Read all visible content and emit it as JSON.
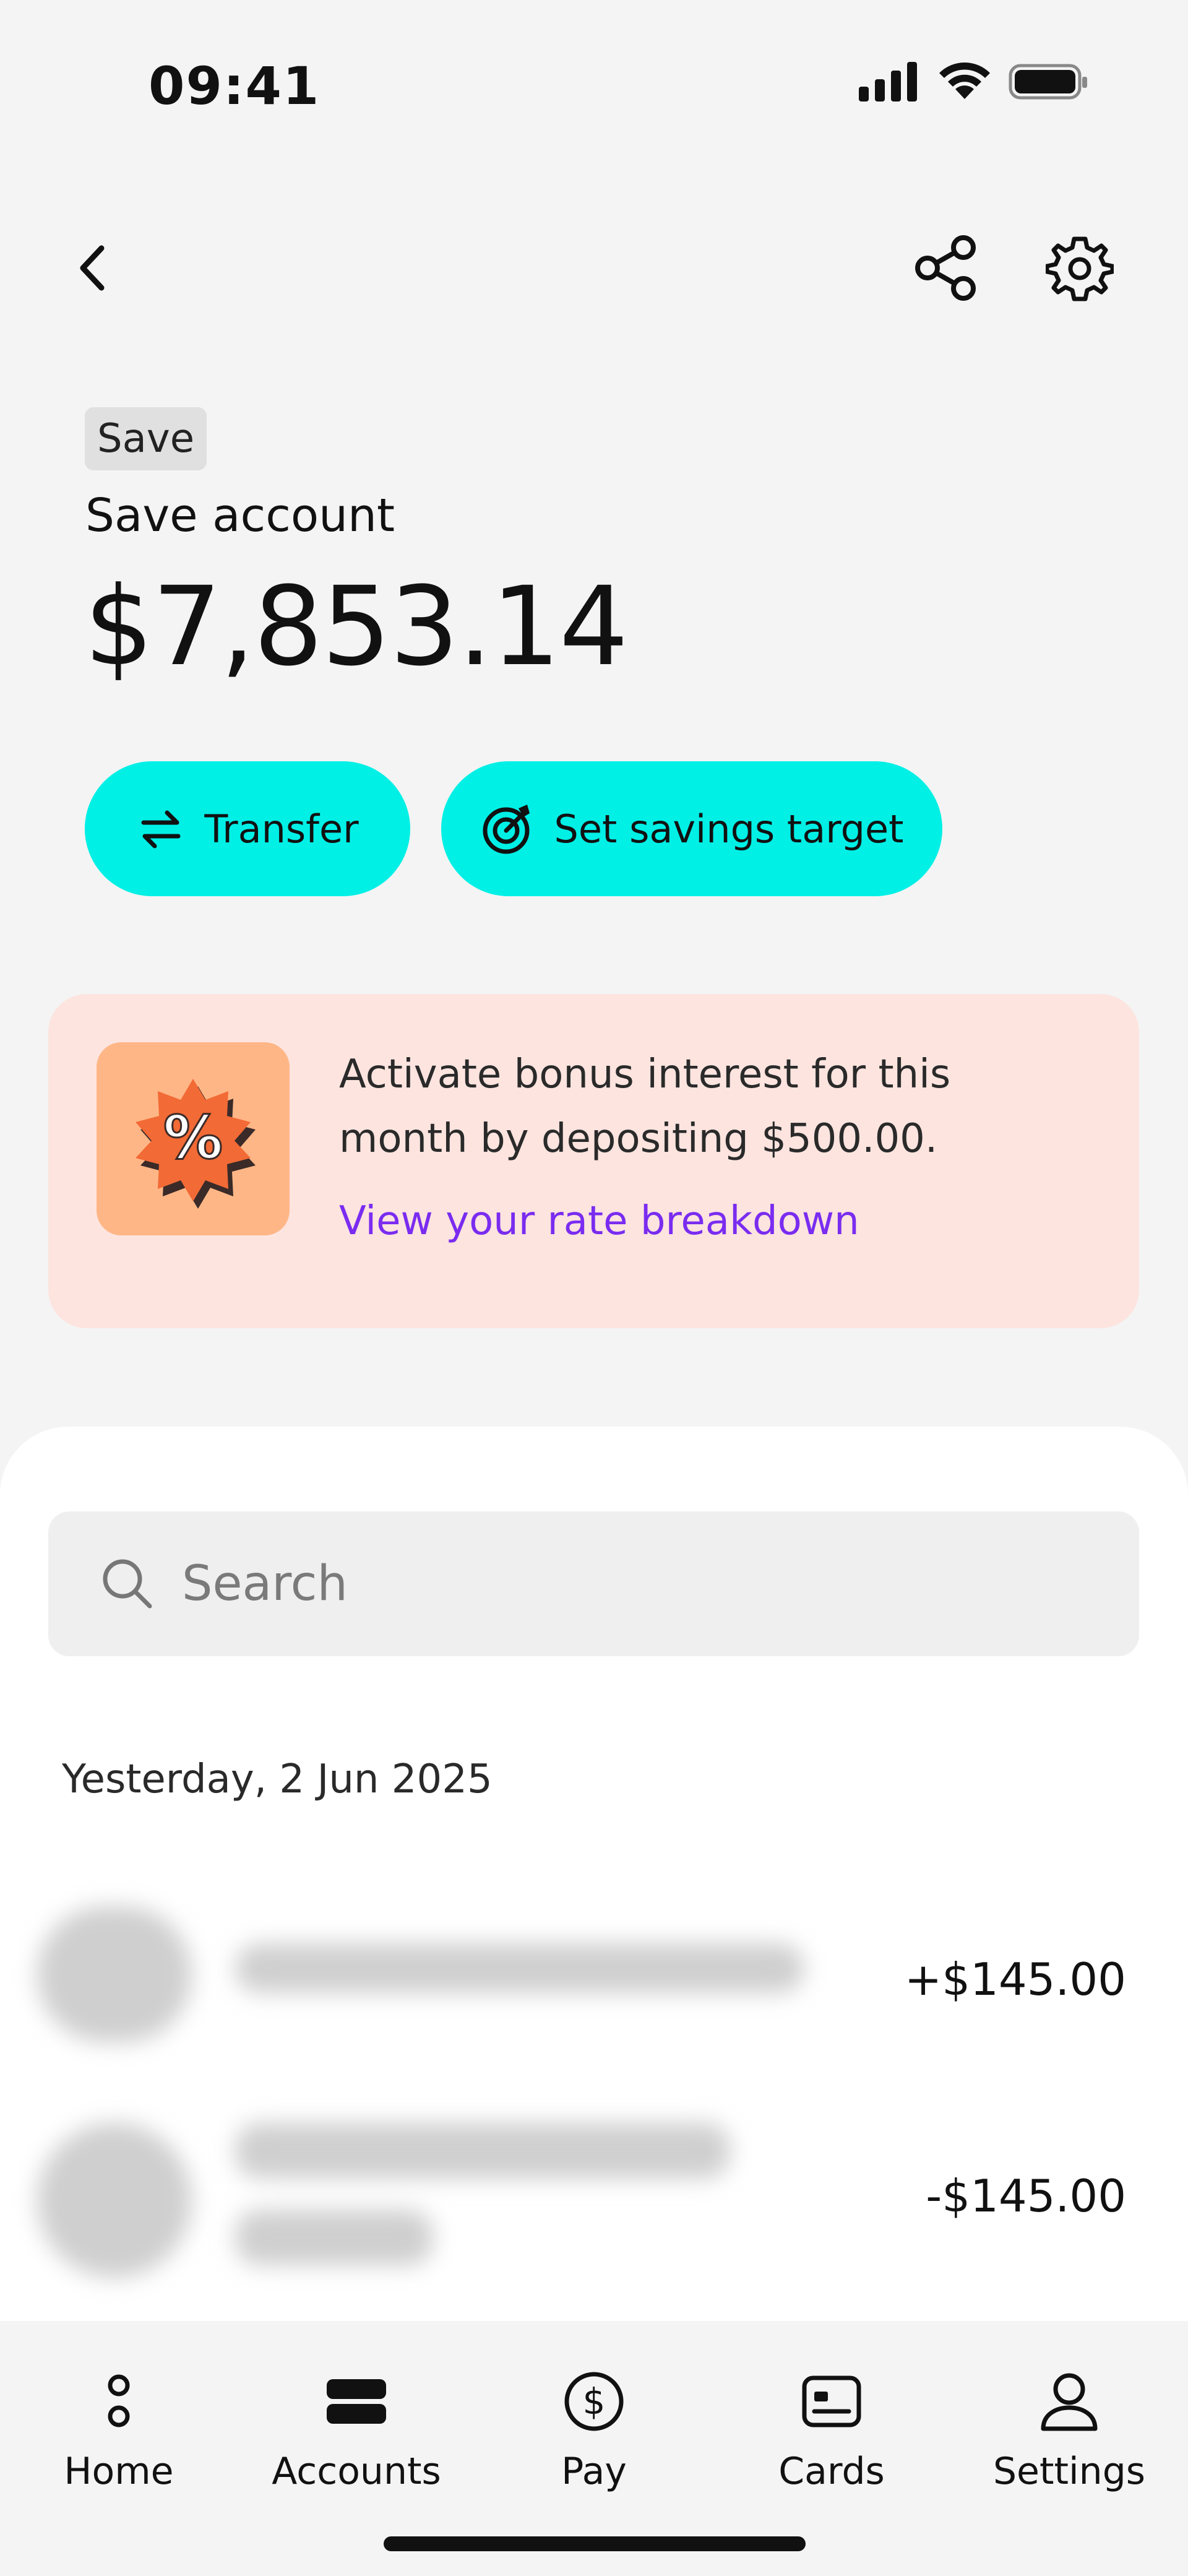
{
  "status_bar": {
    "time": "09:41"
  },
  "account": {
    "tag": "Save",
    "title": "Save account",
    "balance": "$7,853.14"
  },
  "actions": {
    "transfer_label": "Transfer",
    "savings_target_label": "Set savings target"
  },
  "promo": {
    "text": "Activate bonus interest for this month by depositing $500.00.",
    "link": "View your rate breakdown",
    "badge_symbol": "%"
  },
  "search": {
    "placeholder": "Search"
  },
  "transactions": {
    "date_heading": "Yesterday, 2 Jun 2025",
    "items": [
      {
        "amount": "+$145.00"
      },
      {
        "amount": "-$145.00"
      }
    ]
  },
  "tabs": [
    {
      "label": "Home",
      "icon": "home-icon"
    },
    {
      "label": "Accounts",
      "icon": "accounts-icon"
    },
    {
      "label": "Pay",
      "icon": "pay-icon"
    },
    {
      "label": "Cards",
      "icon": "cards-icon"
    },
    {
      "label": "Settings",
      "icon": "settings-icon"
    }
  ],
  "colors": {
    "accent": "#00f0e6",
    "promo_bg": "#fde4df",
    "link": "#7a2cf0"
  }
}
